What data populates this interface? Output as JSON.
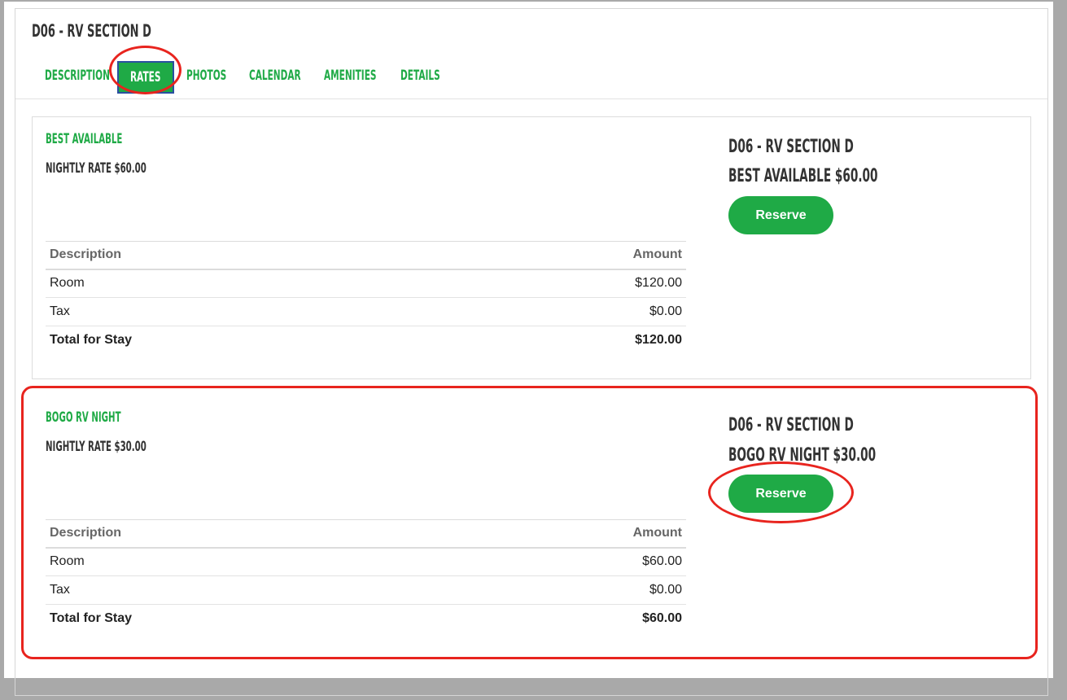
{
  "site": {
    "title": "D06 - RV SECTION D"
  },
  "tabs": [
    {
      "label": "DESCRIPTION"
    },
    {
      "label": "RATES"
    },
    {
      "label": "PHOTOS"
    },
    {
      "label": "CALENDAR"
    },
    {
      "label": "AMENITIES"
    },
    {
      "label": "DETAILS"
    }
  ],
  "active_tab": "RATES",
  "table_headers": {
    "description": "Description",
    "amount": "Amount"
  },
  "rates": [
    {
      "title": "BEST AVAILABLE",
      "nightly": "NIGHTLY RATE $60.00",
      "side_name": "D06 - RV SECTION D",
      "side_rate": "BEST AVAILABLE $60.00",
      "reserve_label": "Reserve",
      "rows": [
        {
          "description": "Room",
          "amount": "$120.00"
        },
        {
          "description": "Tax",
          "amount": "$0.00"
        },
        {
          "description": "Total for Stay",
          "amount": "$120.00"
        }
      ]
    },
    {
      "title": "BOGO RV NIGHT",
      "nightly": "NIGHTLY RATE $30.00",
      "side_name": "D06 - RV SECTION D",
      "side_rate": "BOGO RV NIGHT $30.00",
      "reserve_label": "Reserve",
      "rows": [
        {
          "description": "Room",
          "amount": "$60.00"
        },
        {
          "description": "Tax",
          "amount": "$0.00"
        },
        {
          "description": "Total for Stay",
          "amount": "$60.00"
        }
      ]
    }
  ],
  "colors": {
    "accent": "#1faa46",
    "annotation": "#e8241e",
    "text": "#333333"
  }
}
